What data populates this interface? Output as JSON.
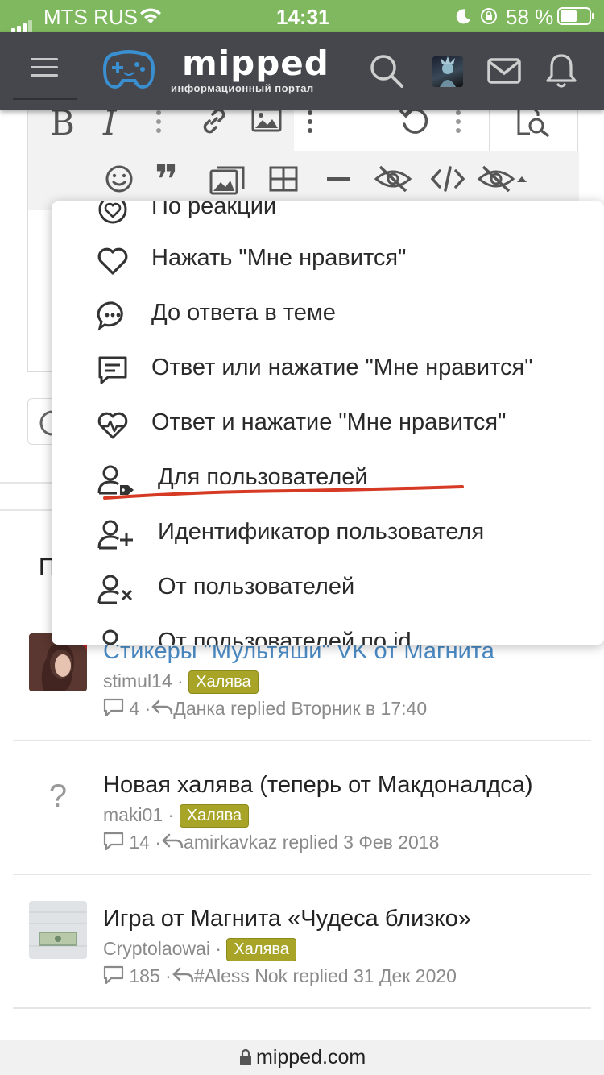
{
  "status_bar": {
    "carrier": "MTS RUS",
    "time": "14:31",
    "battery": "58 %"
  },
  "header": {
    "logo_text": "mipped",
    "logo_subtitle": "информационный портал"
  },
  "editor": {
    "toolbar_row1": [
      "bold-icon",
      "italic-icon",
      "more-icon",
      "link-icon",
      "image-icon",
      "more-icon",
      "undo-icon",
      "more-icon",
      "preview-icon"
    ],
    "toolbar_row2": [
      "smiley-icon",
      "quote-icon",
      "media-icon",
      "table-icon",
      "hr-icon",
      "hide-icon",
      "code-icon",
      "hide-dropdown-icon"
    ]
  },
  "menu": {
    "items": [
      {
        "label": "По реакции",
        "icon": "reaction-icon"
      },
      {
        "label": "Нажать \"Мне нравится\"",
        "icon": "heart-icon"
      },
      {
        "label": "До ответа в теме",
        "icon": "chat-bubble-icon"
      },
      {
        "label": "Ответ или нажатие \"Мне нравится\"",
        "icon": "message-square-icon"
      },
      {
        "label": "Ответ и нажатие \"Мне нравится\"",
        "icon": "heart-pulse-icon"
      },
      {
        "label": "Для пользователей",
        "icon": "user-tag-icon"
      },
      {
        "label": "Идентификатор пользователя",
        "icon": "user-plus-icon"
      },
      {
        "label": "От пользователей",
        "icon": "user-x-icon"
      },
      {
        "label": "От пользователей по id",
        "icon": "user-icon"
      }
    ],
    "underline_color": "#d63a24"
  },
  "behind_menu_letter": "П",
  "threads": [
    {
      "title": "Стикеры \"Мультяши\" VK от Магнита",
      "title_color": "#4a8ac4",
      "author": "stimul14",
      "tag": "Халява",
      "replies": "4",
      "last_reply": "Данка replied Вторник в 17:40"
    },
    {
      "title": "Новая халява (теперь от Макдоналдса)",
      "title_color": "#222222",
      "author": "maki01",
      "tag": "Халява",
      "replies": "14",
      "last_reply": "amirkavkaz replied 3 Фев 2018",
      "avatar_placeholder": "?"
    },
    {
      "title": "Игра от Магнита «Чудеса близко»",
      "title_color": "#222222",
      "author": "Cryptolaowai",
      "tag": "Халява",
      "replies": "185",
      "last_reply": "#Aless Nok replied 31 Дек 2020"
    }
  ],
  "url_bar": {
    "url": "mipped.com"
  },
  "colors": {
    "status_bar": "#7fb85e",
    "header": "#45474c",
    "tag": "#a7a428",
    "logo_blue": "#3a8fd0"
  }
}
